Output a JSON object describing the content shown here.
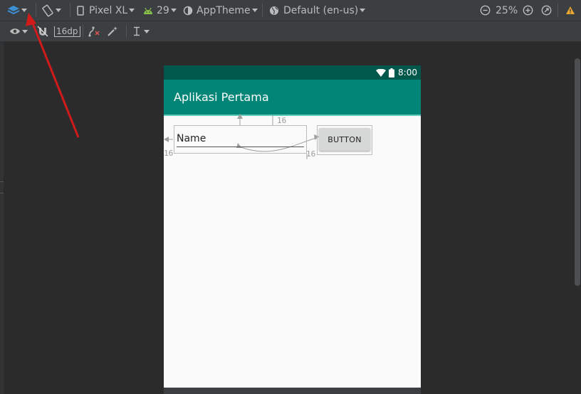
{
  "toolbar": {
    "device": "Pixel XL",
    "api_level": "29",
    "theme": "AppTheme",
    "locale": "Default (en-us)",
    "zoom": "25%",
    "margin": "16dp"
  },
  "device_screen": {
    "status_time": "8:00",
    "app_title": "Aplikasi Pertama",
    "edittext_hint": "Name",
    "button_label": "BUTTON",
    "constraint_top": "16",
    "constraint_left": "16",
    "constraint_right": "16"
  },
  "colors": {
    "toolbar_bg": "#3c3f41",
    "canvas_bg": "#2b2b2b",
    "status_bar": "#00574b",
    "app_bar": "#008577",
    "warning": "#f0a732",
    "annotation_arrow": "#d11a1a"
  }
}
